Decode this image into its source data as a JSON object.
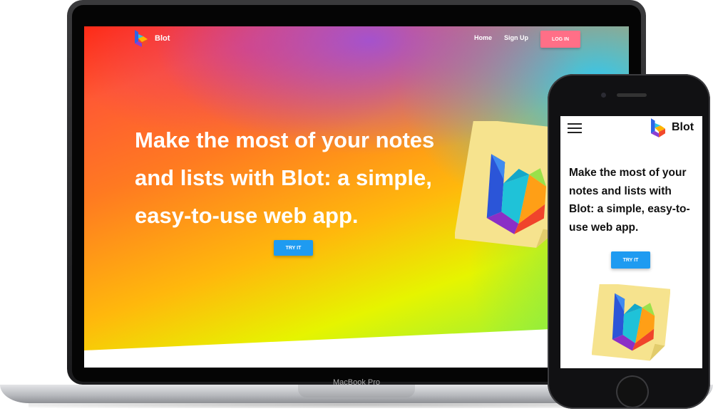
{
  "site": {
    "brand": "Blot",
    "nav": {
      "home": "Home",
      "signup": "Sign Up",
      "login": "LOG IN"
    },
    "headline": "Make the most of your notes and lists with Blot: a simple, easy-to-use web app.",
    "cta": "TRY IT"
  },
  "phone_site": {
    "brand": "Blot",
    "headline": "Make the most of your notes and lists with Blot: a simple, easy-to-use web app.",
    "cta": "TRY IT"
  },
  "device": {
    "laptop_label": "MacBook Pro"
  },
  "icons": {
    "logo": "blot-logo-icon",
    "menu": "hamburger-menu-icon",
    "sticky": "sticky-note-logo-icon"
  },
  "colors": {
    "login_button": "#ff6f87",
    "cta_button": "#1e9bf1",
    "sticky_note": "#f6e38e"
  }
}
